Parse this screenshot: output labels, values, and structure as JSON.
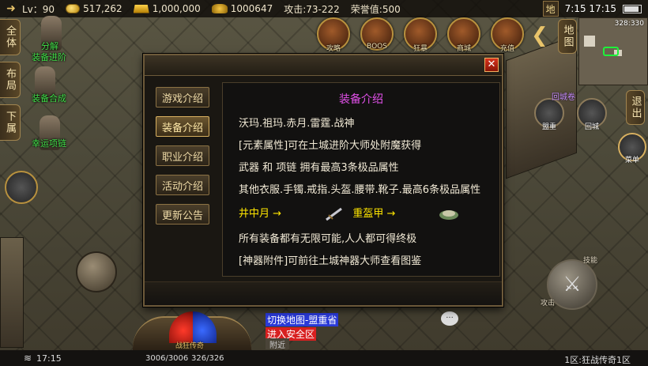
{
  "topbar": {
    "level": "Lv：90",
    "gold": "517,262",
    "ingot": "1,000,000",
    "yuanbao": "1000647",
    "attack": "攻击:73-222",
    "honor": "荣誉值:500",
    "map_btn": "地",
    "time": "7:15  17:15"
  },
  "left_buttons": [
    "全体",
    "布局",
    "下属"
  ],
  "left_links": {
    "decompose": "分解",
    "upgrade": "装备进阶",
    "synth": "装备合成",
    "necklace": "幸运项链"
  },
  "round_icons": [
    {
      "label": "攻略",
      "icon": "strategy-icon"
    },
    {
      "label": "BOOS",
      "icon": "boss-icon"
    },
    {
      "label": "狂暴",
      "icon": "berserk-icon"
    },
    {
      "label": "商城",
      "icon": "shop-icon"
    },
    {
      "label": "充值",
      "icon": "recharge-icon"
    }
  ],
  "right_panel": {
    "map_label": "地图",
    "coords": "328:330",
    "exit_label": "退出",
    "mount_label": "盟重",
    "gate_label": "回城",
    "menu_label": "菜单",
    "scroll_label": "回城卷"
  },
  "modal": {
    "tabs": [
      "游戏介绍",
      "装备介绍",
      "职业介绍",
      "活动介绍",
      "更新公告"
    ],
    "active_tab": 1,
    "title": "装备介绍",
    "lines": [
      "沃玛.祖玛.赤月.雷霆.战神",
      "[元素属性]可在土城进阶大师处附魔获得",
      "武器 和 项链 拥有最高3条极品属性",
      "其他衣服.手镯.戒指.头盔.腰带.靴子.最高6条极品属性"
    ],
    "item_row": {
      "left": "井中月 →",
      "right": "重盔甲 →"
    },
    "lines2": [
      "所有装备都有无限可能,人人都可得终极",
      "[神器附件]可前往土城神器大师查看图鉴"
    ],
    "close": "✕"
  },
  "bottom": {
    "clock": "17:15",
    "hp": "3006/3006",
    "mp": "326/326",
    "orb_label": "战狂传奇",
    "chat_line1": "切换地图-盟重省",
    "chat_line2": "进入安全区",
    "chat_tab": "附近",
    "bubble": "···",
    "server": "1区:狂战传奇1区"
  },
  "skills": {
    "left": "技能",
    "right": "攻击"
  },
  "colors": {
    "title_magenta": "#e050e8",
    "item_yellow": "#ffe600",
    "link_green": "#43e04a"
  }
}
